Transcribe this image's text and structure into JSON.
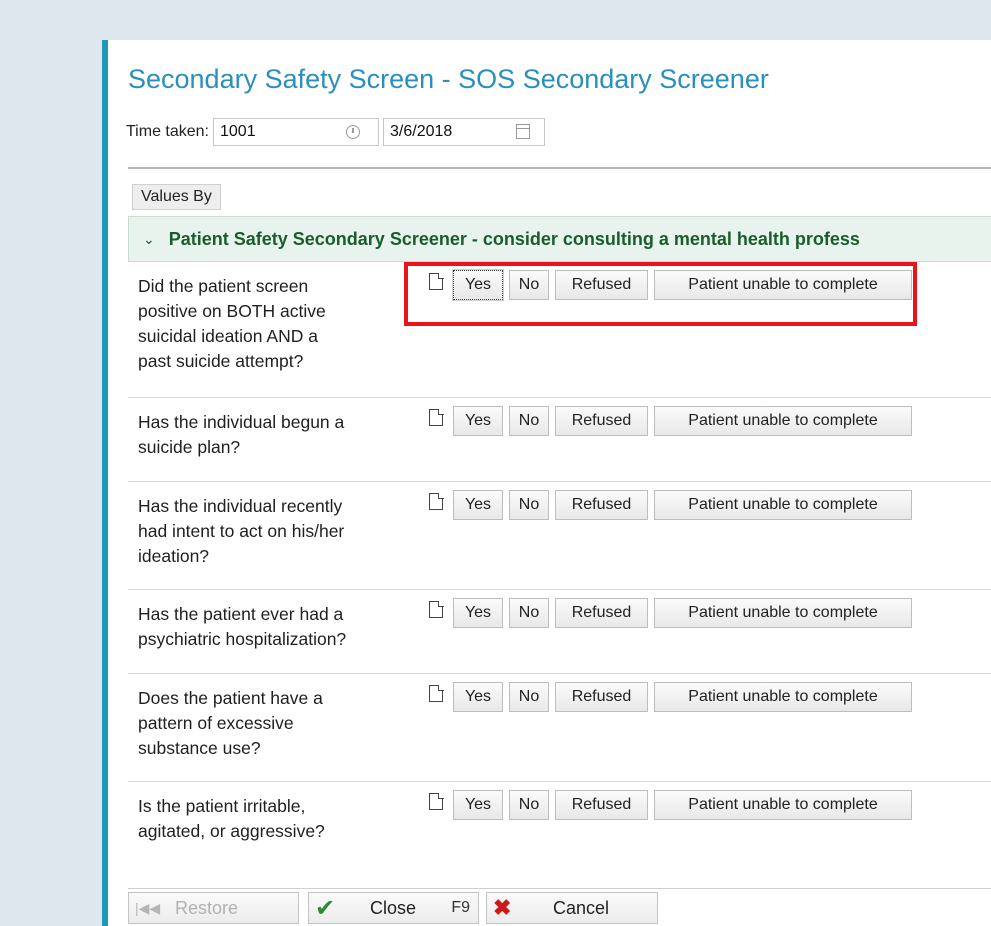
{
  "window": {
    "title": "Secondary Safety Screen - SOS Secondary Screener"
  },
  "time": {
    "label": "Time taken:",
    "time_value": "1001",
    "date_value": "3/6/2018"
  },
  "values_by_label": "Values By",
  "section": {
    "title": "Patient Safety Secondary Screener - consider consulting a mental health profess"
  },
  "options": {
    "yes": "Yes",
    "no": "No",
    "refused": "Refused",
    "unable": "Patient unable to complete"
  },
  "questions": [
    {
      "text": "Did the patient screen positive on BOTH active suicidal ideation AND a past suicide attempt?"
    },
    {
      "text": "Has the individual begun a suicide plan?"
    },
    {
      "text": "Has the individual recently had intent to act on his/her ideation?"
    },
    {
      "text": "Has the patient ever had a psychiatric hospitalization?"
    },
    {
      "text": "Does the patient have a pattern of excessive substance use?"
    },
    {
      "text": "Is the patient irritable, agitated, or aggressive?"
    }
  ],
  "footer": {
    "restore_label": "Restore",
    "close_label": "Close",
    "close_shortcut": "F9",
    "cancel_label": "Cancel"
  },
  "colors": {
    "accent": "#1f97b8",
    "title": "#2a8fbf",
    "section_text": "#1a5d2d",
    "highlight": "#e8131b"
  }
}
